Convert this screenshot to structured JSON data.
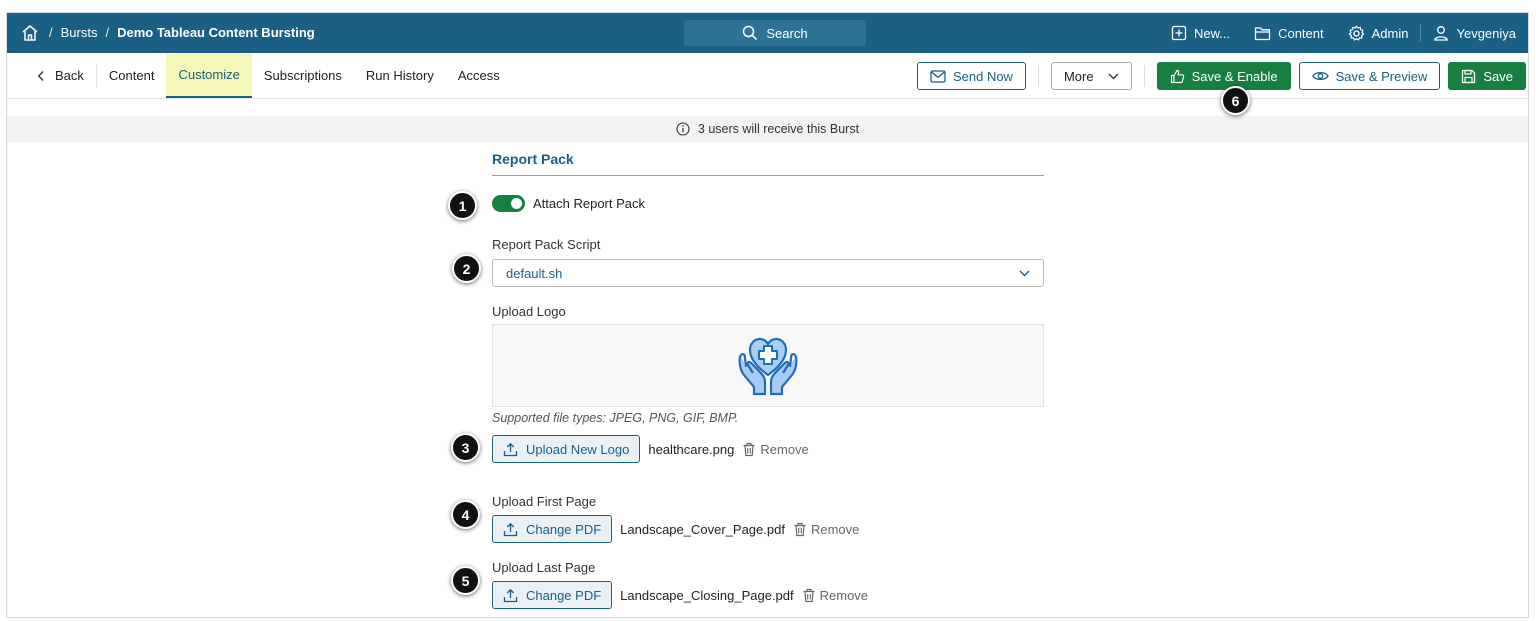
{
  "topbar": {
    "crumb_sep": "/",
    "crumb_bursts": "Bursts",
    "crumb_current": "Demo Tableau Content Bursting",
    "search_label": "Search",
    "nav": {
      "new": "New...",
      "content": "Content",
      "admin": "Admin",
      "user": "Yevgeniya"
    }
  },
  "subbar": {
    "tabs": {
      "back": "Back",
      "content": "Content",
      "customize": "Customize",
      "subscriptions": "Subscriptions",
      "run_history": "Run History",
      "access": "Access"
    },
    "actions": {
      "send_now": "Send Now",
      "more": "More",
      "save_enable": "Save & Enable",
      "save_preview": "Save & Preview",
      "save": "Save"
    }
  },
  "info": {
    "text": "3 users will receive this Burst"
  },
  "form": {
    "section_title": "Report Pack",
    "attach_label": "Attach Report Pack",
    "attach_enabled": true,
    "script_label": "Report Pack Script",
    "script_value": "default.sh",
    "logo_label": "Upload Logo",
    "logo_hint": "Supported file types: JPEG, PNG, GIF, BMP.",
    "logo_button": "Upload New Logo",
    "logo_file": "healthcare.png",
    "remove_label": "Remove",
    "first_label": "Upload First Page",
    "first_button": "Change PDF",
    "first_file": "Landscape_Cover_Page.pdf",
    "last_label": "Upload Last Page",
    "last_button": "Change PDF",
    "last_file": "Landscape_Closing_Page.pdf"
  },
  "badges": [
    "1",
    "2",
    "3",
    "4",
    "5",
    "6"
  ],
  "colors": {
    "brand": "#1a5f84",
    "green": "#17803f",
    "highlight": "#f5f7b8"
  }
}
